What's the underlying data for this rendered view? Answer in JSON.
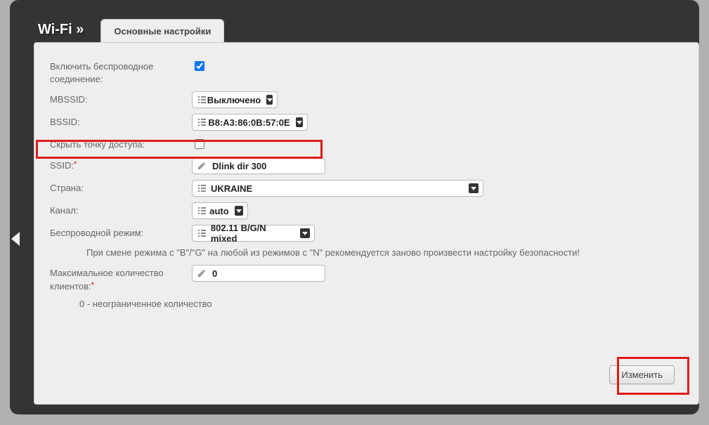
{
  "header": {
    "title": "Wi-Fi »"
  },
  "tabs": {
    "active": "Основные настройки"
  },
  "fields": {
    "enable": {
      "label": "Включить беспроводное соединение:",
      "checked": true
    },
    "mbssid": {
      "label": "MBSSID:",
      "value": "Выключено"
    },
    "bssid": {
      "label": "BSSID:",
      "value": "B8:A3:86:0B:57:0E"
    },
    "hide_ap": {
      "label": "Скрыть точку доступа:",
      "checked": false
    },
    "ssid": {
      "label": "SSID:",
      "required": "*",
      "value": "Dlink dir 300"
    },
    "country": {
      "label": "Страна:",
      "value": "UKRAINE"
    },
    "channel": {
      "label": "Канал:",
      "value": "auto"
    },
    "mode": {
      "label": "Беспроводной режим:",
      "value": "802.11 B/G/N mixed"
    },
    "max_clients": {
      "label": "Максимальное количество клиентов:",
      "required": "*",
      "value": "0"
    }
  },
  "notes": {
    "mode_note": "При смене режима с \"B\"/\"G\" на любой из режимов с \"N\" рекомендуется заново произвести настройку безопасности!",
    "max_note": "0 - неограниченное количество"
  },
  "actions": {
    "apply": "Изменить"
  }
}
